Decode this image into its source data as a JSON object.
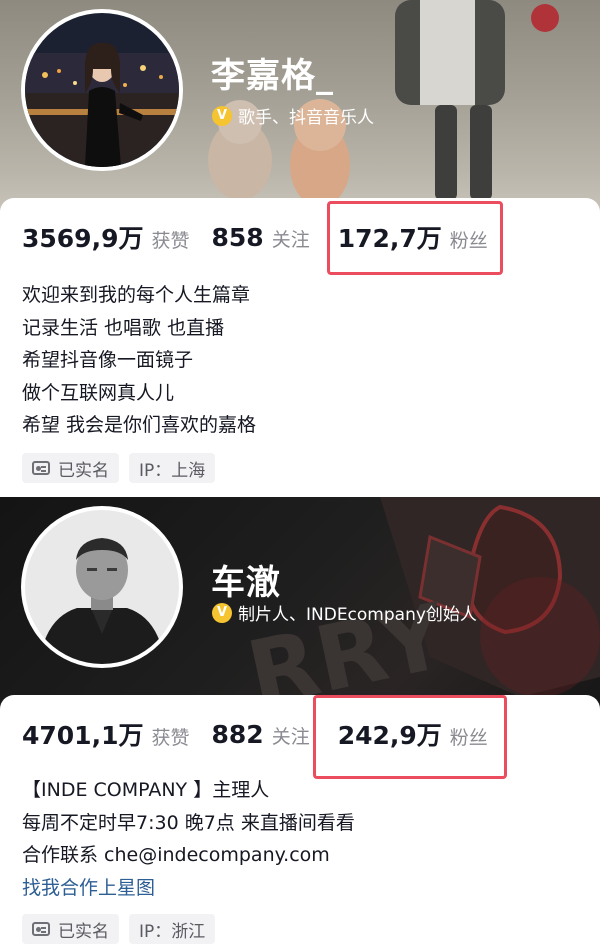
{
  "profiles": [
    {
      "name": "李嘉格_",
      "verified": "歌手、抖音音乐人",
      "likes_num": "3569,9万",
      "likes_label": "获赞",
      "following_num": "858",
      "following_label": "关注",
      "followers_num": "172,7万",
      "followers_label": "粉丝",
      "bio": [
        "欢迎来到我的每个人生篇章",
        "记录生活  也唱歌 也直播",
        "希望抖音像一面镜子",
        "做个互联网真人儿",
        "希望 我会是你们喜欢的嘉格"
      ],
      "tag_verified": "已实名",
      "tag_ip": "IP：上海"
    },
    {
      "name": "车澈",
      "verified": "制片人、INDEcompany创始人",
      "likes_num": "4701,1万",
      "likes_label": "获赞",
      "following_num": "882",
      "following_label": "关注",
      "followers_num": "242,9万",
      "followers_label": "粉丝",
      "bio": [
        "【INDE COMPANY 】主理人",
        "每周不定时早7:30 晚7点 来直播间看看",
        "合作联系 che@indecompany.com"
      ],
      "link": "找我合作上星图",
      "tag_verified": "已实名",
      "tag_ip": "IP：浙江"
    }
  ],
  "icons": {
    "verified_badge": "v-badge-icon",
    "id_card": "id-card-icon"
  },
  "colors": {
    "highlight": "#ec4d5e",
    "verified": "#f5c430",
    "link": "#2e5f94"
  }
}
